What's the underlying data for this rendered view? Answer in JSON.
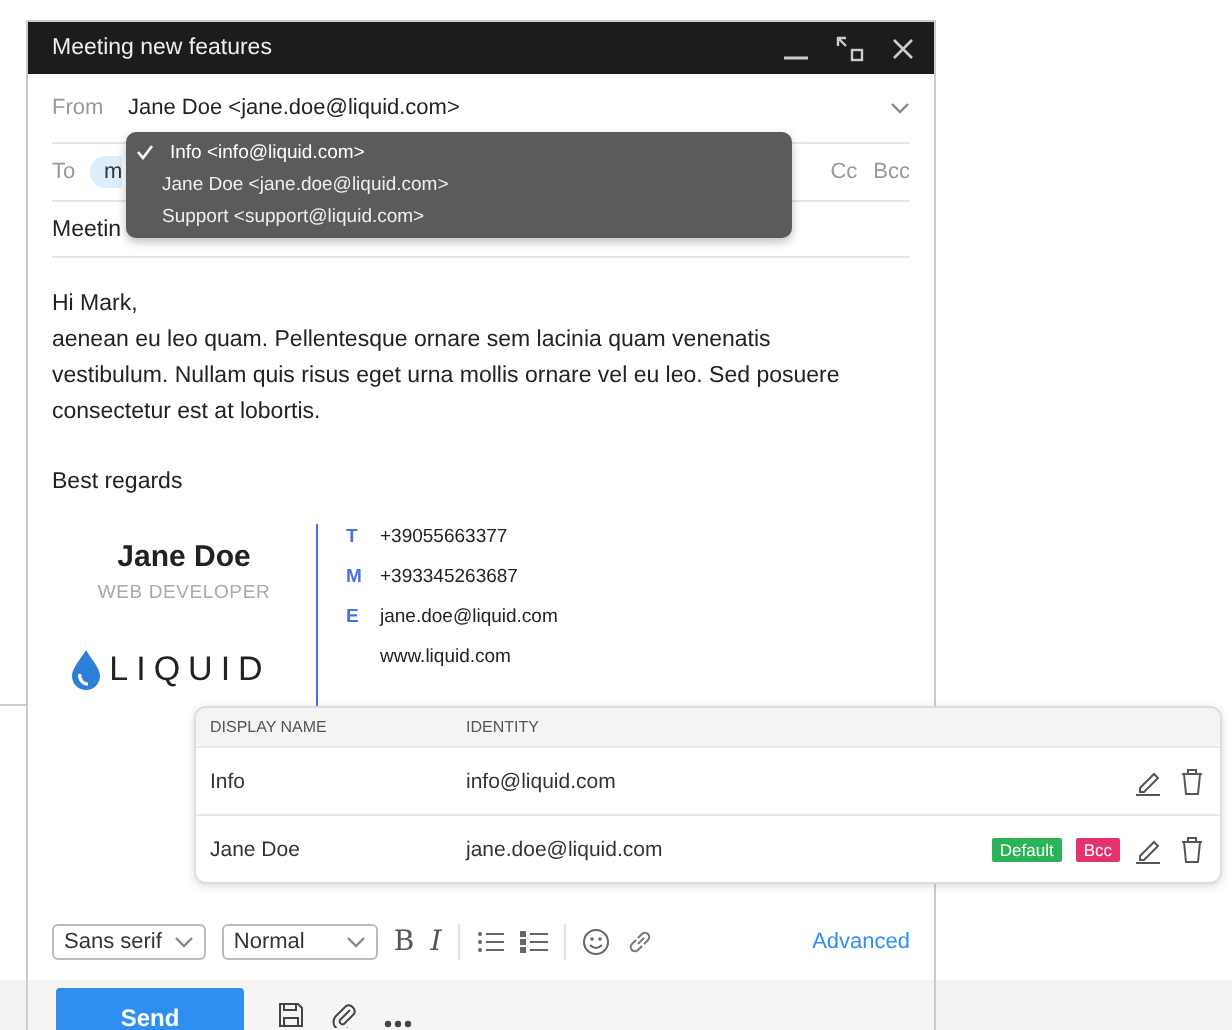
{
  "window": {
    "title": "Meeting new features"
  },
  "from": {
    "label": "From",
    "value": "Jane Doe <jane.doe@liquid.com>"
  },
  "to": {
    "label": "To",
    "chip": "m",
    "cc": "Cc",
    "bcc": "Bcc"
  },
  "subject": {
    "value": "Meetin"
  },
  "from_menu": [
    {
      "label": "Info <info@liquid.com>",
      "selected": true
    },
    {
      "label": "Jane Doe <jane.doe@liquid.com>",
      "selected": false
    },
    {
      "label": "Support <support@liquid.com>",
      "selected": false
    }
  ],
  "body": {
    "greeting": "Hi Mark,",
    "paragraph": "aenean eu leo quam. Pellentesque ornare sem lacinia quam venenatis vestibulum. Nullam quis risus eget urna mollis ornare vel eu leo. Sed posuere consectetur est at lobortis.",
    "closing": "Best regards"
  },
  "signature": {
    "name": "Jane Doe",
    "role": "WEB DEVELOPER",
    "logo": "LIQUID",
    "contacts": [
      {
        "key": "T",
        "value": "+39055663377"
      },
      {
        "key": "M",
        "value": "+393345263687"
      },
      {
        "key": "E",
        "value": "jane.doe@liquid.com"
      },
      {
        "value": "www.liquid.com"
      }
    ]
  },
  "identities": {
    "columns": [
      "DISPLAY NAME",
      "IDENTITY"
    ],
    "rows": [
      {
        "name": "Info",
        "identity": "info@liquid.com"
      },
      {
        "name": "Jane Doe",
        "identity": "jane.doe@liquid.com",
        "badges": [
          {
            "label": "Default",
            "color": "#2bb35a"
          },
          {
            "label": "Bcc",
            "color": "#e5326e"
          }
        ]
      }
    ]
  },
  "toolbar": {
    "font": "Sans serif",
    "size": "Normal",
    "bold": "B",
    "italic": "I",
    "advanced": "Advanced"
  },
  "send": "Send"
}
